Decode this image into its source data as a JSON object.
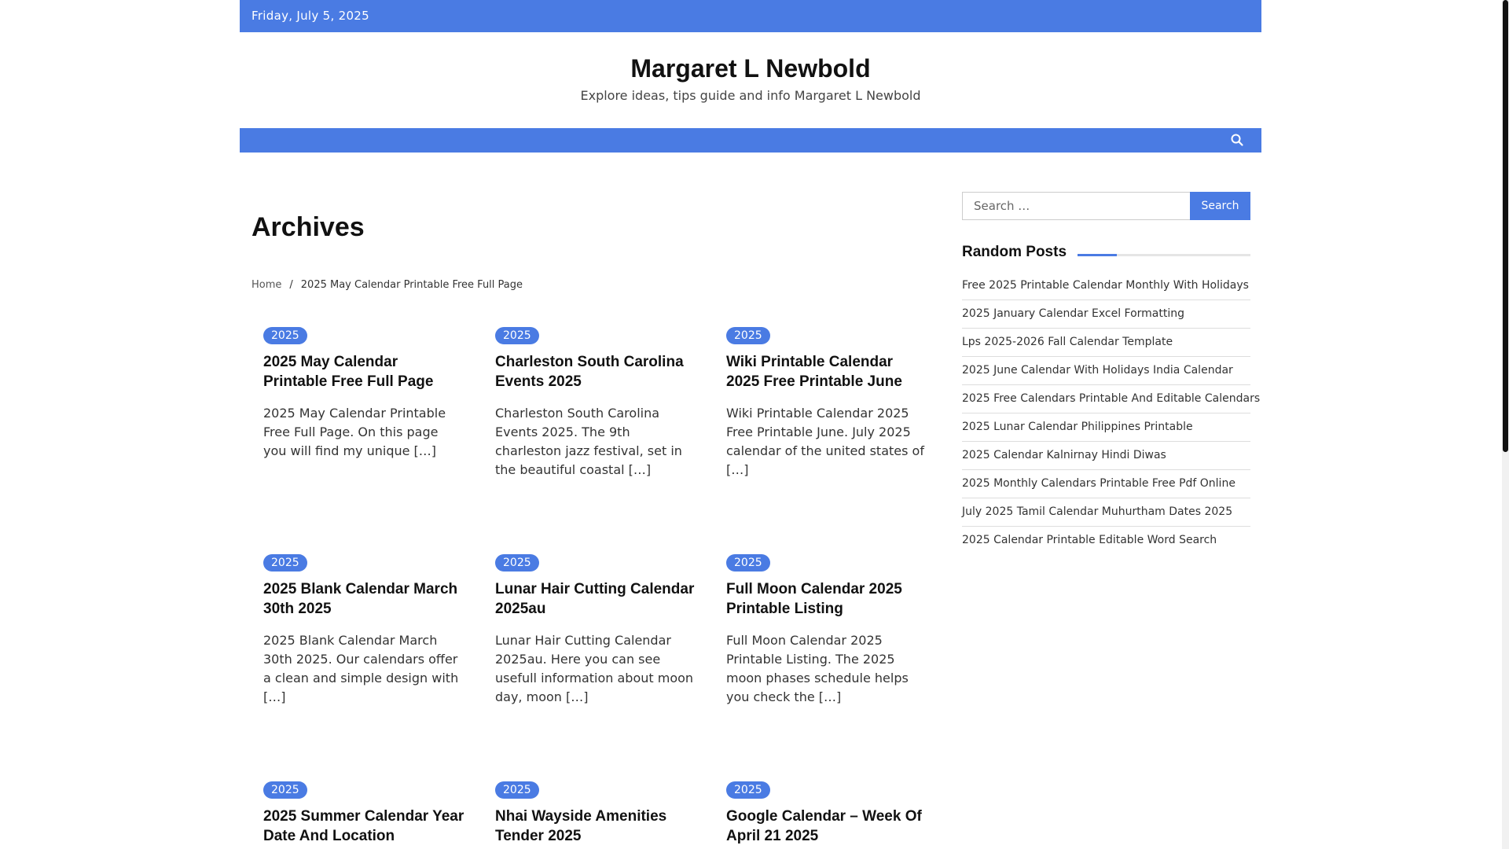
{
  "topbar": {
    "date": "Friday, July 5, 2025"
  },
  "brand": {
    "site_title": "Margaret L Newbold",
    "tagline": "Explore ideas, tips guide and info Margaret L Newbold"
  },
  "navbar": {
    "search_icon": "search-icon"
  },
  "archive": {
    "title": "Archives",
    "breadcrumb": {
      "home": "Home",
      "separator": "/",
      "current": "2025 May Calendar Printable Free Full Page"
    }
  },
  "posts": [
    {
      "category": "2025",
      "title": "2025 May Calendar Printable Free Full Page",
      "excerpt": "2025 May Calendar Printable Free Full Page. On this page you will find my unique […]"
    },
    {
      "category": "2025",
      "title": "Charleston South Carolina Events 2025",
      "excerpt": "Charleston South Carolina Events 2025. The 9th charleston jazz festival, set in the beautiful coastal […]"
    },
    {
      "category": "2025",
      "title": "Wiki Printable Calendar 2025 Free Printable June",
      "excerpt": "Wiki Printable Calendar 2025 Free Printable June. July 2025 calendar of the united states of […]"
    },
    {
      "category": "2025",
      "title": "2025 Blank Calendar March 30th 2025",
      "excerpt": "2025 Blank Calendar March 30th 2025. Our calendars offer a clean and simple design with […]"
    },
    {
      "category": "2025",
      "title": "Lunar Hair Cutting Calendar 2025au",
      "excerpt": "Lunar Hair Cutting Calendar 2025au. Here you can see usefull information about moon day, moon […]"
    },
    {
      "category": "2025",
      "title": "Full Moon Calendar 2025 Printable Listing",
      "excerpt": "Full Moon Calendar 2025 Printable Listing. The 2025 moon phases schedule helps you check the […]"
    },
    {
      "category": "2025",
      "title": "2025 Summer Calendar Year Date And Location",
      "excerpt": ""
    },
    {
      "category": "2025",
      "title": "Nhai Wayside Amenities Tender 2025",
      "excerpt": ""
    },
    {
      "category": "2025",
      "title": "Google Calendar – Week Of April 21 2025",
      "excerpt": ""
    }
  ],
  "sidebar": {
    "search": {
      "placeholder": "Search …",
      "button": "Search"
    },
    "random_posts": {
      "title": "Random Posts",
      "items": [
        "Free 2025 Printable Calendar Monthly With Holidays",
        "2025 January Calendar Excel Formatting",
        "Lps 2025-2026 Fall Calendar Template",
        "2025 June Calendar With Holidays India Calendar",
        "2025 Free Calendars Printable And Editable Calendars",
        "2025 Lunar Calendar Philippines Printable",
        "2025 Calendar Kalnirnay Hindi Diwas",
        "2025 Monthly Calendars Printable Free Pdf Online",
        "July 2025 Tamil Calendar Muhurtham Dates 2025",
        "2025 Calendar Printable Editable Word Search"
      ]
    }
  },
  "colors": {
    "accent": "#4a7be3",
    "text": "#222222"
  }
}
